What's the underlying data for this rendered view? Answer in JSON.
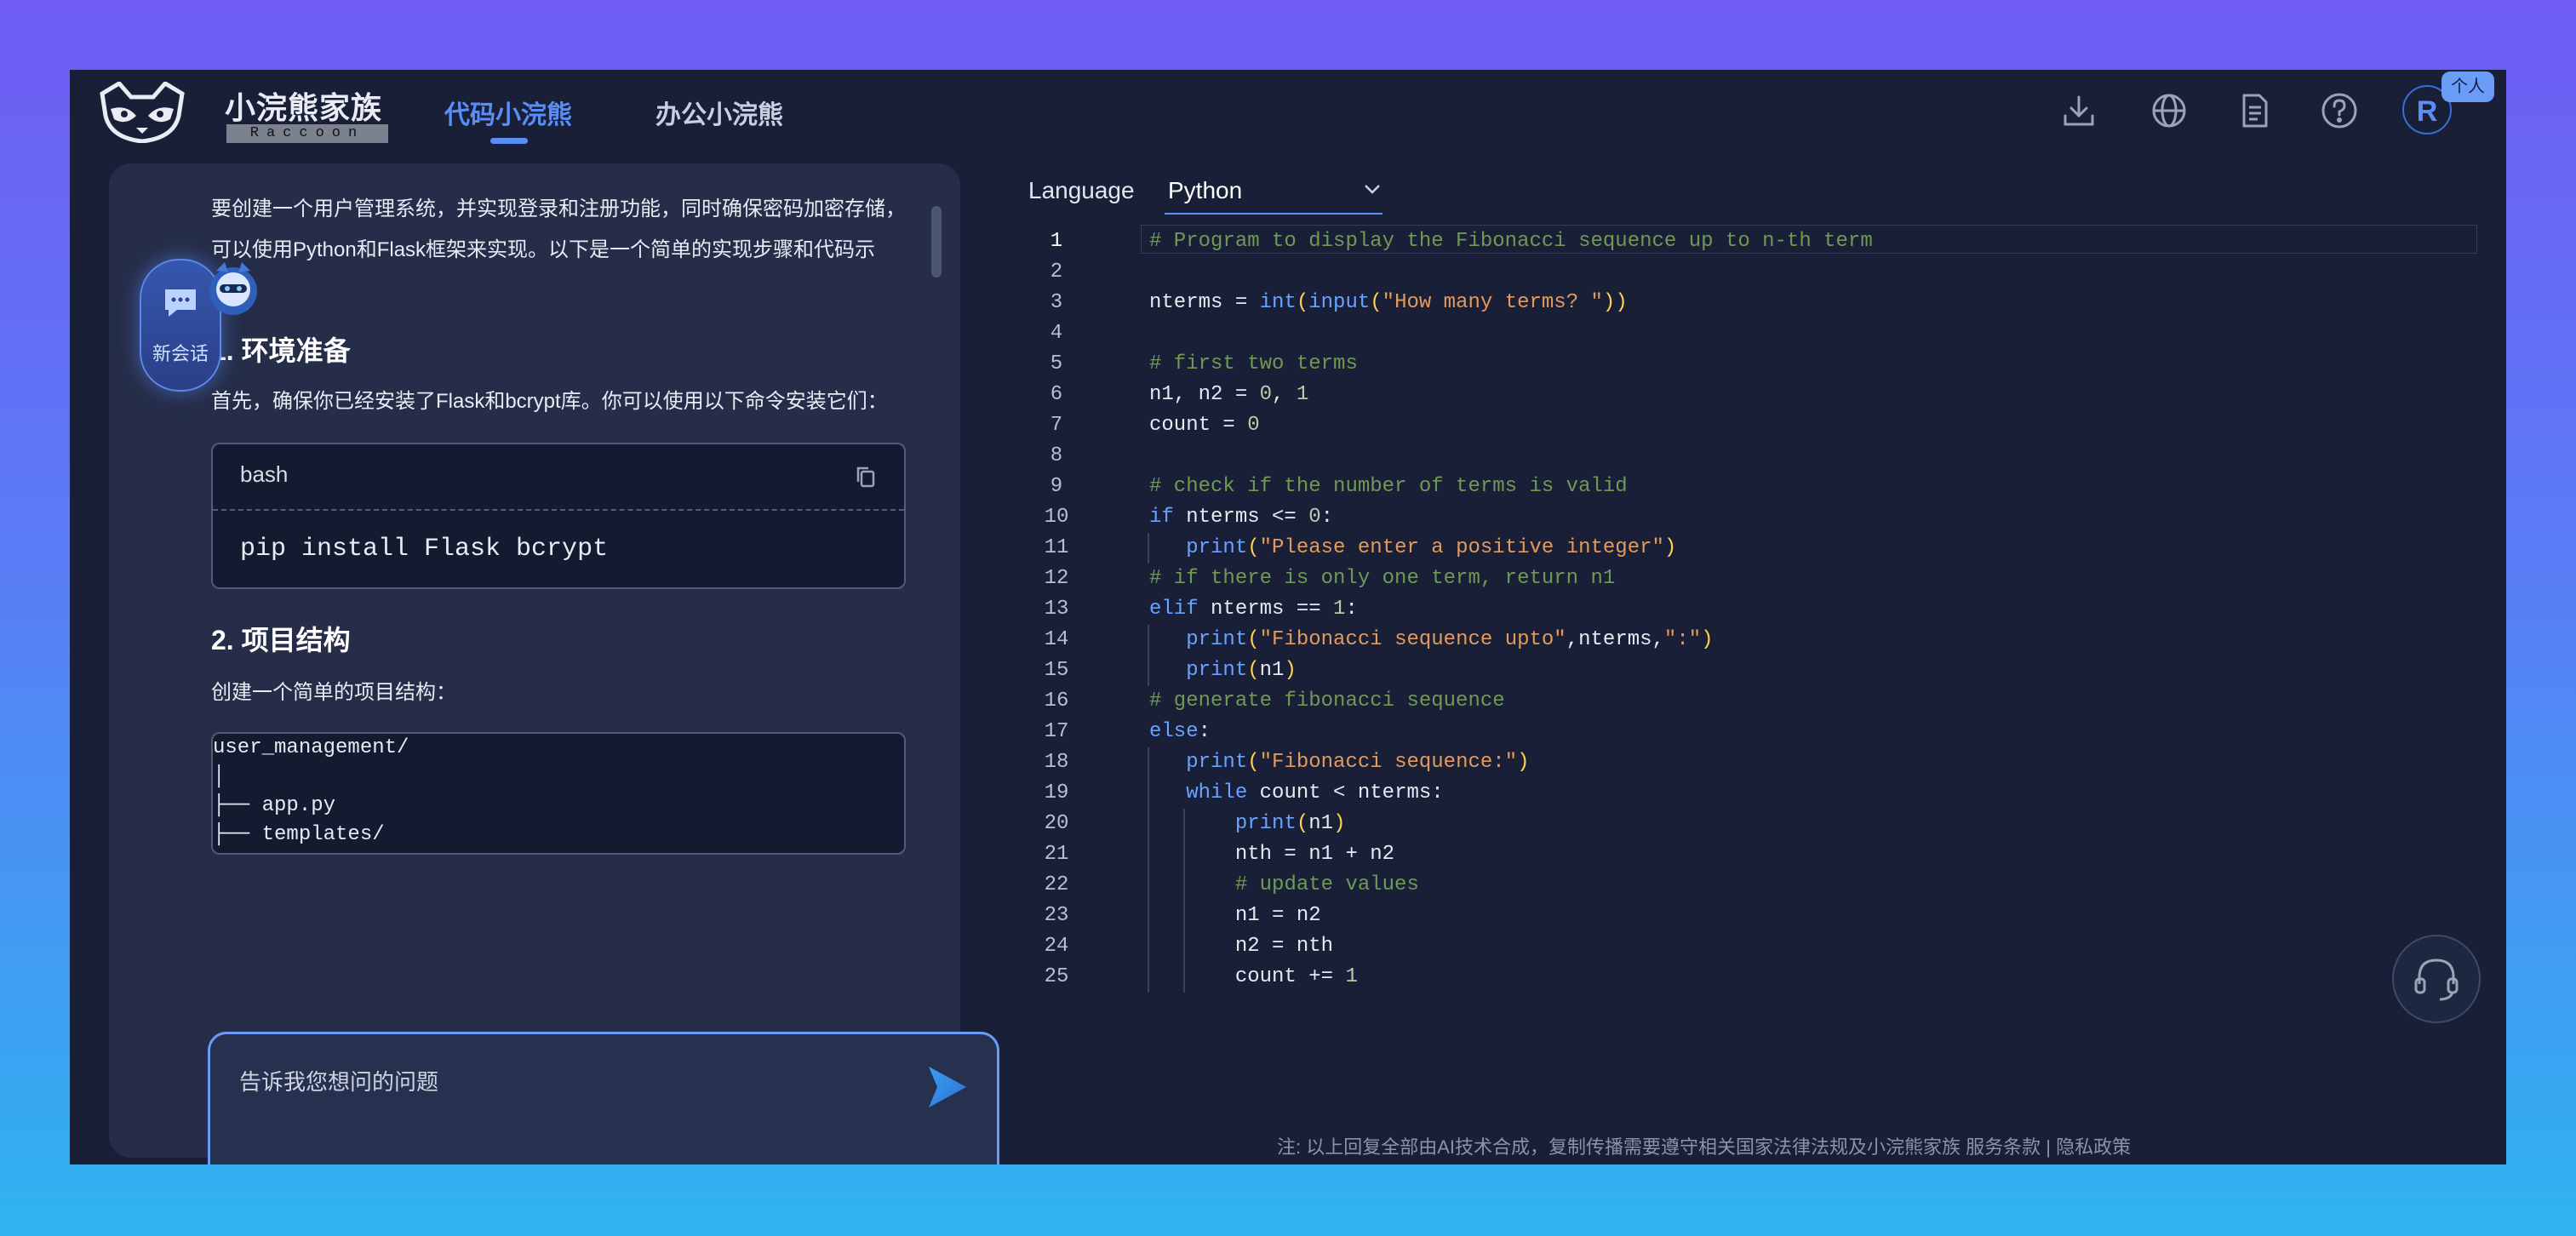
{
  "brand": {
    "name_cn": "小浣熊家族",
    "name_en": "Raccoon"
  },
  "nav": {
    "tabs": [
      {
        "label": "代码小浣熊",
        "active": true
      },
      {
        "label": "办公小浣熊",
        "active": false
      }
    ]
  },
  "header": {
    "icons": [
      "download-icon",
      "globe-icon",
      "document-icon",
      "help-icon"
    ],
    "avatar_letter": "R",
    "personal_badge": "个人"
  },
  "sidebar": {
    "new_chat_label": "新会话"
  },
  "chat": {
    "intro": "要创建一个用户管理系统，并实现登录和注册功能，同时确保密码加密存储，可以使用Python和Flask框架来实现。以下是一个简单的实现步骤和代码示例。",
    "h1": "1. 环境准备",
    "p1": "首先，确保你已经安装了Flask和bcrypt库。你可以使用以下命令安装它们：",
    "code_lang": "bash",
    "code": "pip install Flask bcrypt",
    "h2": "2. 项目结构",
    "p2": "创建一个简单的项目结构：",
    "tree": [
      "user_management/",
      "│",
      "├── app.py",
      "├── templates/"
    ]
  },
  "input": {
    "placeholder": "告诉我您想问的问题"
  },
  "editor": {
    "language_label": "Language",
    "language": "Python",
    "lines": [
      "# Program to display the Fibonacci sequence up to n-th term",
      "",
      "nterms = int(input(\"How many terms? \"))",
      "",
      "# first two terms",
      "n1, n2 = 0, 1",
      "count = 0",
      "",
      "# check if the number of terms is valid",
      "if nterms <= 0:",
      "   print(\"Please enter a positive integer\")",
      "# if there is only one term, return n1",
      "elif nterms == 1:",
      "   print(\"Fibonacci sequence upto\",nterms,\":\")",
      "   print(n1)",
      "# generate fibonacci sequence",
      "else:",
      "   print(\"Fibonacci sequence:\")",
      "   while count < nterms:",
      "       print(n1)",
      "       nth = n1 + n2",
      "       # update values",
      "       n1 = n2",
      "       n2 = nth",
      "       count += 1"
    ]
  },
  "footer": {
    "text": "注: 以上回复全部由AI技术合成，复制传播需要遵守相关国家法律法规及小浣熊家族 服务条款 | 隐私政策"
  },
  "colors": {
    "accent": "#5b8ef5",
    "keyword": "#6aa2ff",
    "string": "#e39a5c",
    "comment": "#6f9955",
    "number": "#b5cea8"
  }
}
